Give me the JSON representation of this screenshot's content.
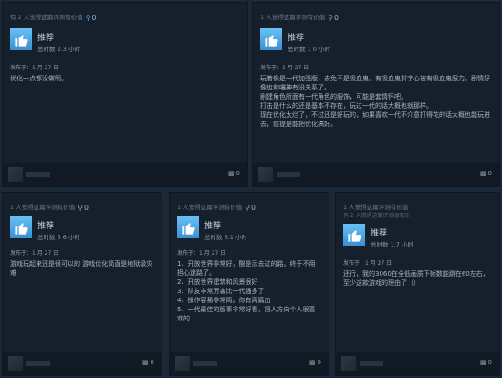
{
  "reviews": [
    {
      "helpful_text": "有 2 人觉得这篇评测有价值",
      "award_count": "0",
      "sub_text": "",
      "verdict": "推荐",
      "hours": "总时数 2.3 小时",
      "posted": "发布于：1 月 27 日",
      "body": [
        "优化一点都没做啊。"
      ],
      "comment_count": "0"
    },
    {
      "helpful_text": "1 人觉得这篇评测有价值",
      "award_count": "0",
      "sub_text": "",
      "verdict": "推荐",
      "hours": "总时数 1 0 小时",
      "posted": "发布于：1 月 27 日",
      "body": [
        "玩着像是一代加强版，去免不是吸血鬼，有吸血鬼抖字心被有吸血鬼服力，剧情好像也和嘎神有没关系了。",
        "剧建角色所面有一代角色的服饰，可能是套情怀吧。",
        "打击是什么的还是基本不存在，玩过一代的话大概也就那样。",
        "现在优化太烂了，不过还是好玩的，如果喜欢一代不介意打得花的话大概也能玩进去，前提是能把优化搞好。"
      ],
      "comment_count": "0"
    },
    {
      "helpful_text": "1 人觉得这篇评测有价值",
      "award_count": "0",
      "sub_text": "",
      "verdict": "推荐",
      "hours": "总时数 5 6 小时",
      "posted": "发布于：1 月 27 日",
      "body": [
        "游戏玩起来还是很可以的 游戏优化简直是地狱级灾难"
      ],
      "comment_count": "0"
    },
    {
      "helpful_text": "1 人觉得这篇评测有价值",
      "award_count": "0",
      "sub_text": "",
      "verdict": "推荐",
      "hours": "总时数 6.1 小时",
      "posted": "发布于：1 月 27 日",
      "body": [
        "1、开放世界非常好，酸是示去过的路。终于不用担心迷路了。",
        "2、开放世界建筑和风景很好",
        "3、队友非常厉害比一代强多了",
        "4、操作容易非常简。你有两篇血",
        "5、一代最佳的股事非常好看，把人方向个人很喜欢的"
      ],
      "comment_count": "0"
    },
    {
      "helpful_text": "1 人觉得这篇评测有价值",
      "award_count": "",
      "sub_text": "有 2 人觉得这篇评测很欢乐",
      "verdict": "推荐",
      "hours": "总时数 1.7 小时",
      "posted": "发布于：1 月 27 日",
      "body": [
        "还行，我的3060在全低画质下帧数能跳在60左右，至少这款游戏的理由了（）"
      ],
      "comment_count": "0"
    }
  ],
  "icons": {
    "award": "award-ribbon-icon",
    "thumb": "thumbs-up-icon",
    "comment": "comment-bubble-icon"
  },
  "colors": {
    "background": "#1b2838",
    "card": "#16202d",
    "thumb": "#4d9be0",
    "text": "#acb2b8"
  }
}
